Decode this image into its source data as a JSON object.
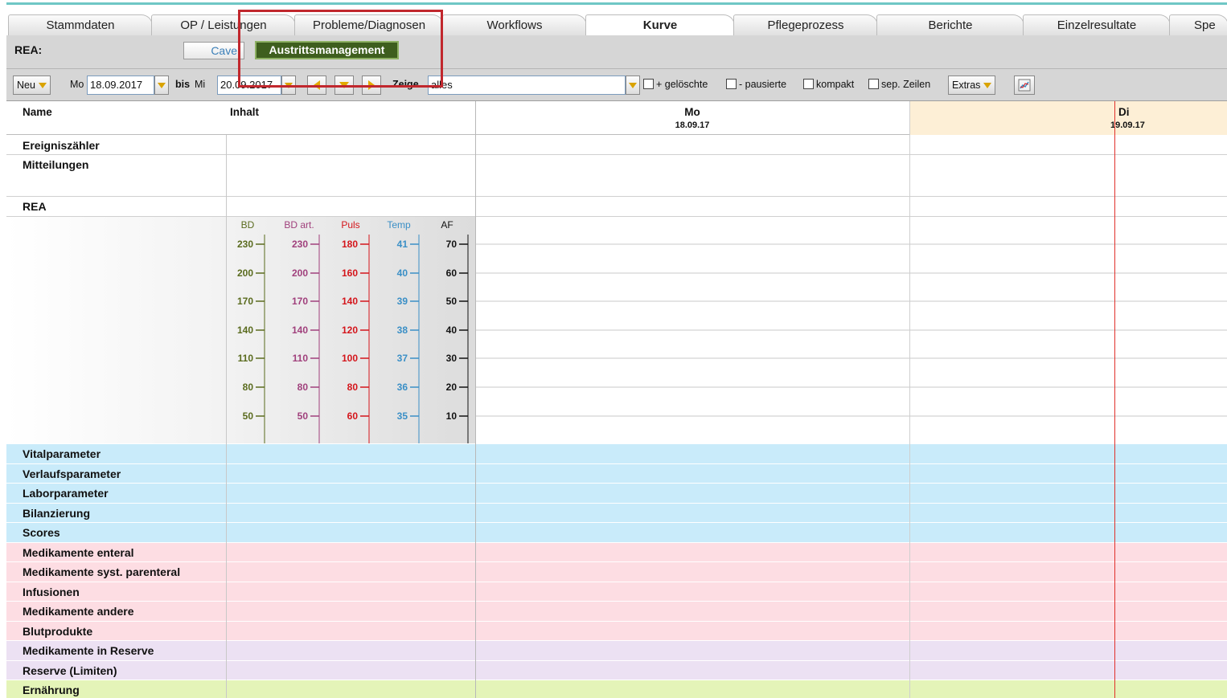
{
  "tabs": [
    {
      "label": "Stammdaten",
      "active": false
    },
    {
      "label": "OP / Leistungen",
      "active": false
    },
    {
      "label": "Probleme/Diagnosen",
      "active": false
    },
    {
      "label": "Workflows",
      "active": false
    },
    {
      "label": "Kurve",
      "active": true
    },
    {
      "label": "Pflegeprozess",
      "active": false
    },
    {
      "label": "Berichte",
      "active": false
    },
    {
      "label": "Einzelresultate",
      "active": false
    },
    {
      "label": "Spe",
      "active": false
    }
  ],
  "rea_bar": {
    "label": "REA:",
    "cave_button": "Cave",
    "austritt_button": "Austrittsmanagement"
  },
  "toolbar": {
    "neu_label": "Neu",
    "from_day": "Mo",
    "from_date": "18.09.2017",
    "bis_label": "bis",
    "to_day": "Mi",
    "to_date": "20.09.2017",
    "zeige_label": "Zeige",
    "zeige_value": "alles",
    "checkboxes": [
      {
        "label": "+ gelöschte",
        "checked": false
      },
      {
        "label": "- pausierte",
        "checked": false
      },
      {
        "label": "kompakt",
        "checked": false
      },
      {
        "label": "sep. Zeilen",
        "checked": false
      }
    ],
    "extras_label": "Extras"
  },
  "grid": {
    "name_header": "Name",
    "inhalt_header": "Inhalt",
    "days": [
      {
        "name": "Mo",
        "date": "18.09.17"
      },
      {
        "name": "Di",
        "date": "19.09.17"
      }
    ],
    "top_rows": [
      "Ereigniszähler",
      "Mitteilungen",
      "REA"
    ],
    "scales": [
      {
        "label": "BD",
        "color": "#5a6b1e",
        "values": [
          "230",
          "200",
          "170",
          "140",
          "110",
          "80",
          "50"
        ]
      },
      {
        "label": "BD art.",
        "color": "#a0407c",
        "values": [
          "230",
          "200",
          "170",
          "140",
          "110",
          "80",
          "50"
        ]
      },
      {
        "label": "Puls",
        "color": "#d4151b",
        "values": [
          "180",
          "160",
          "140",
          "120",
          "100",
          "80",
          "60"
        ]
      },
      {
        "label": "Temp",
        "color": "#3a8fc6",
        "values": [
          "41",
          "40",
          "39",
          "38",
          "37",
          "36",
          "35"
        ]
      },
      {
        "label": "AF",
        "color": "#111111",
        "values": [
          "70",
          "60",
          "50",
          "40",
          "30",
          "20",
          "10"
        ]
      }
    ],
    "sections": [
      {
        "label": "Vitalparameter",
        "color": "#c9ebfa"
      },
      {
        "label": "Verlaufsparameter",
        "color": "#c9ebfa"
      },
      {
        "label": "Laborparameter",
        "color": "#c9ebfa"
      },
      {
        "label": "Bilanzierung",
        "color": "#c9ebfa"
      },
      {
        "label": "Scores",
        "color": "#c9ebfa"
      },
      {
        "label": "Medikamente enteral",
        "color": "#fddde3"
      },
      {
        "label": "Medikamente syst. parenteral",
        "color": "#fddde3"
      },
      {
        "label": "Infusionen",
        "color": "#fddde3"
      },
      {
        "label": "Medikamente andere",
        "color": "#fddde3"
      },
      {
        "label": "Blutprodukte",
        "color": "#fddde3"
      },
      {
        "label": "Medikamente in Reserve",
        "color": "#ece1f3"
      },
      {
        "label": "Reserve (Limiten)",
        "color": "#ece1f3"
      },
      {
        "label": "Ernährung",
        "color": "#e4f4b8"
      }
    ]
  }
}
